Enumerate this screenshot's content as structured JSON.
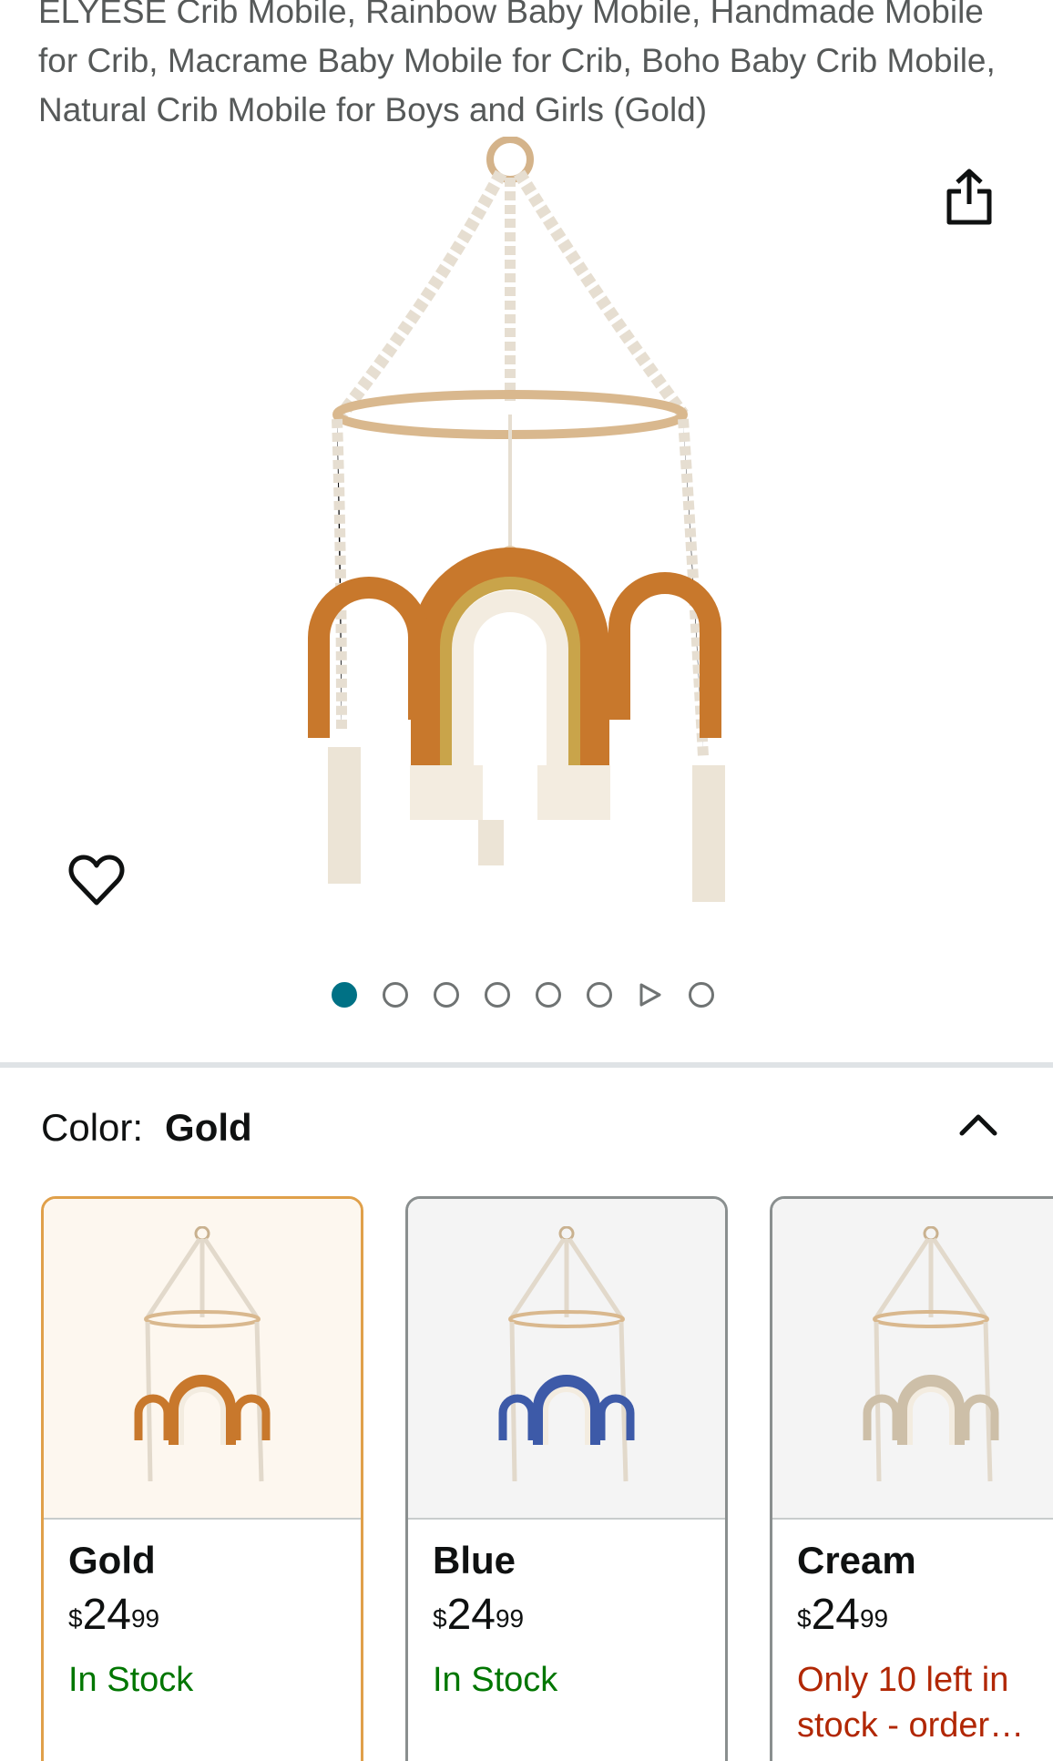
{
  "product": {
    "title": "ELYESE Crib Mobile, Rainbow Baby Mobile, Handmade Mobile for Crib, Macrame Baby Mobile for Crib, Boho Baby Crib Mobile, Natural Crib Mobile for Boys and Girls (Gold)"
  },
  "icons": {
    "share": "share-icon",
    "favorite": "heart-icon",
    "collapse": "chevron-up-icon",
    "video": "play-icon"
  },
  "gallery": {
    "selected_index": 1,
    "image_count": 7,
    "has_video": true
  },
  "variation": {
    "label": "Color:",
    "selected": "Gold"
  },
  "swatches": [
    {
      "name": "Gold",
      "currency": "$",
      "price_whole": "24",
      "price_fraction": "99",
      "availability": "In Stock",
      "arch_color": "#c8782c"
    },
    {
      "name": "Blue",
      "currency": "$",
      "price_whole": "24",
      "price_fraction": "99",
      "availability": "In Stock",
      "arch_color": "#3d5aa8"
    },
    {
      "name": "Cream",
      "currency": "$",
      "price_whole": "24",
      "price_fraction": "99",
      "availability": "Only 10 left in stock - order…",
      "arch_color": "#cdbfa8"
    }
  ],
  "colors": {
    "accent": "#007185",
    "in_stock": "#007600",
    "low_stock": "#b12704",
    "selected_border": "#e0a04a"
  }
}
